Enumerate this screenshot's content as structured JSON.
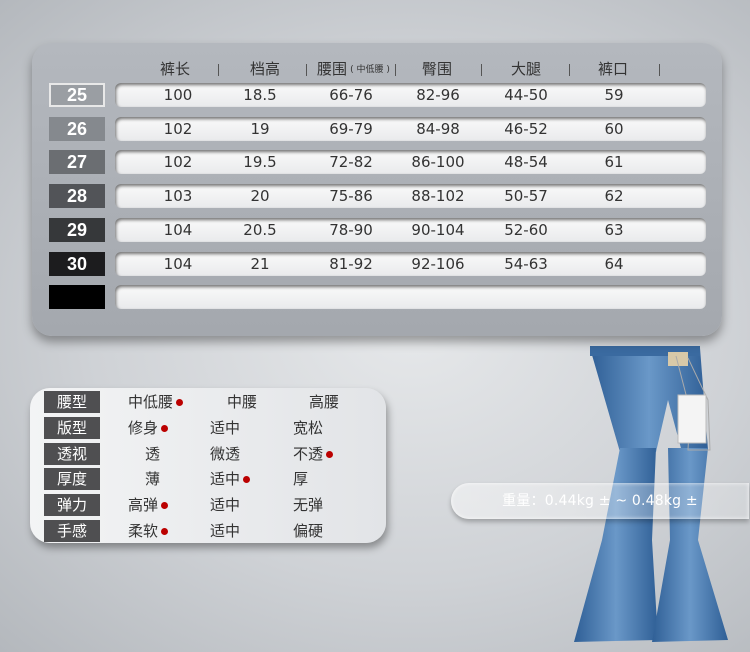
{
  "size_table": {
    "columns": [
      "裤长",
      "档高",
      "腰围",
      "臀围",
      "大腿",
      "裤口"
    ],
    "waist_note": "( 中低腰 )",
    "rows": [
      {
        "size": "25",
        "values": [
          "100",
          "18.5",
          "66-76",
          "82-96",
          "44-50",
          "59"
        ]
      },
      {
        "size": "26",
        "values": [
          "102",
          "19",
          "69-79",
          "84-98",
          "46-52",
          "60"
        ]
      },
      {
        "size": "27",
        "values": [
          "102",
          "19.5",
          "72-82",
          "86-100",
          "48-54",
          "61"
        ]
      },
      {
        "size": "28",
        "values": [
          "103",
          "20",
          "75-86",
          "88-102",
          "50-57",
          "62"
        ]
      },
      {
        "size": "29",
        "values": [
          "104",
          "20.5",
          "78-90",
          "90-104",
          "52-60",
          "63"
        ]
      },
      {
        "size": "30",
        "values": [
          "104",
          "21",
          "81-92",
          "92-106",
          "54-63",
          "64"
        ]
      }
    ],
    "size_label_colors": [
      "#9a9ea3",
      "#85898e",
      "#6b6e72",
      "#525458",
      "#36383a",
      "#1c1c1e",
      "#000000"
    ]
  },
  "attributes": [
    {
      "label": "腰型",
      "options": [
        "中低腰",
        "中腰",
        "高腰"
      ],
      "selected": 0
    },
    {
      "label": "版型",
      "options": [
        "修身",
        "适中",
        "宽松"
      ],
      "selected": 0
    },
    {
      "label": "透视",
      "options": [
        "透",
        "微透",
        "不透"
      ],
      "selected": 2
    },
    {
      "label": "厚度",
      "options": [
        "薄",
        "适中",
        "厚"
      ],
      "selected": 1
    },
    {
      "label": "弹力",
      "options": [
        "高弹",
        "适中",
        "无弹"
      ],
      "selected": 0
    },
    {
      "label": "手感",
      "options": [
        "柔软",
        "适中",
        "偏硬"
      ],
      "selected": 0
    }
  ],
  "weight_text": "重量：0.44kg ± ~ 0.48kg ±",
  "colors": {
    "selected_dot": "#bb0000",
    "denim": "#4a7ab0"
  }
}
